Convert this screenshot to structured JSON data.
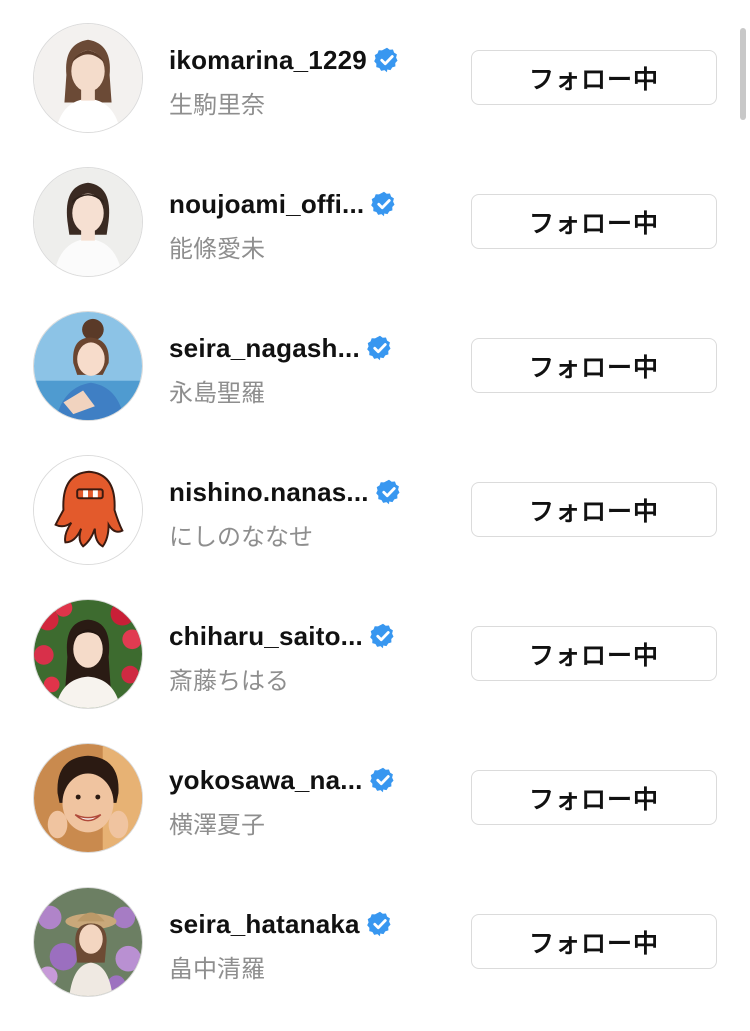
{
  "follow_button_label": "フォロー中",
  "accounts": [
    {
      "username": "ikomarina_1229",
      "name": "生駒里奈",
      "avatar_icon": "photo-avatar"
    },
    {
      "username": "noujoami_offi...",
      "name": "能條愛未",
      "avatar_icon": "photo-avatar"
    },
    {
      "username": "seira_nagash...",
      "name": "永島聖羅",
      "avatar_icon": "photo-avatar"
    },
    {
      "username": "nishino.nanas...",
      "name": "にしのななせ",
      "avatar_icon": "octopus-avatar"
    },
    {
      "username": "chiharu_saito...",
      "name": "斎藤ちはる",
      "avatar_icon": "photo-avatar"
    },
    {
      "username": "yokosawa_na...",
      "name": "横澤夏子",
      "avatar_icon": "photo-avatar"
    },
    {
      "username": "seira_hatanaka",
      "name": "畠中清羅",
      "avatar_icon": "photo-avatar"
    }
  ],
  "colors": {
    "verified": "#3897f0",
    "secondary_text": "#8e8e8e",
    "border": "#dbdbdb"
  }
}
